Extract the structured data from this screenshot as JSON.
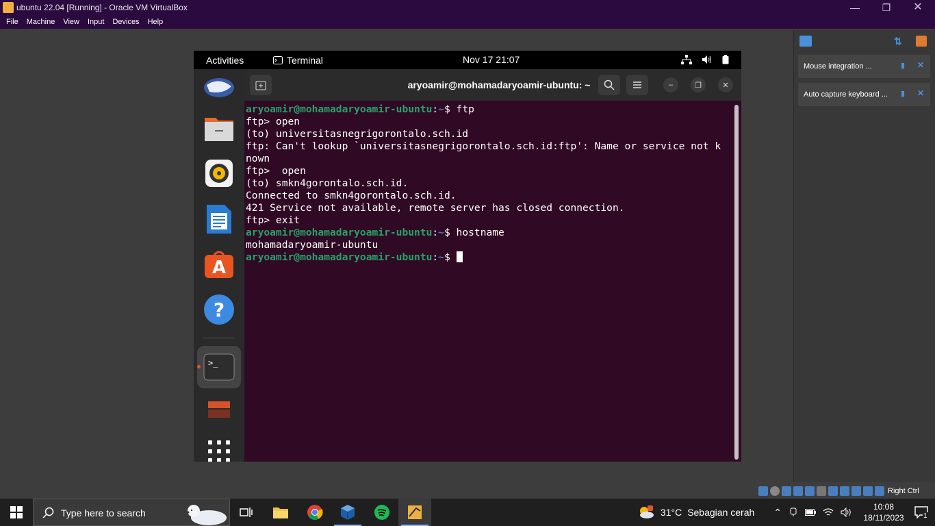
{
  "vbox": {
    "title": "ubuntu 22.04 [Running] - Oracle VM VirtualBox",
    "menu": [
      "File",
      "Machine",
      "View",
      "Input",
      "Devices",
      "Help"
    ],
    "notifications": [
      {
        "text": "Mouse integration ..."
      },
      {
        "text": "Auto capture keyboard ..."
      }
    ],
    "host_key": "Right Ctrl"
  },
  "gnome": {
    "activities": "Activities",
    "app_name": "Terminal",
    "clock": "Nov 17  21:07"
  },
  "terminal": {
    "title": "aryoamir@mohamadaryoamir-ubuntu: ~",
    "prompt_user": "aryoamir@mohamadaryoamir-ubuntu",
    "prompt_path": "~",
    "lines": [
      {
        "type": "prompt",
        "cmd": " ftp"
      },
      {
        "type": "text",
        "text": "ftp> open"
      },
      {
        "type": "text",
        "text": "(to) universitasnegrigorontalo.sch.id"
      },
      {
        "type": "text",
        "text": "ftp: Can't lookup `universitasnegrigorontalo.sch.id:ftp': Name or service not k"
      },
      {
        "type": "text",
        "text": "nown"
      },
      {
        "type": "text",
        "text": "ftp>  open"
      },
      {
        "type": "text",
        "text": "(to) smkn4gorontalo.sch.id."
      },
      {
        "type": "text",
        "text": "Connected to smkn4gorontalo.sch.id."
      },
      {
        "type": "text",
        "text": "421 Service not available, remote server has closed connection."
      },
      {
        "type": "text",
        "text": "ftp> exit"
      },
      {
        "type": "prompt",
        "cmd": " hostname"
      },
      {
        "type": "text",
        "text": "mohamadaryoamir-ubuntu"
      },
      {
        "type": "prompt",
        "cmd": " ",
        "cursor": true
      }
    ]
  },
  "taskbar": {
    "search_placeholder": "Type here to search",
    "weather_temp": "31°C",
    "weather_desc": "Sebagian cerah",
    "time": "10:08",
    "date": "18/11/2023",
    "notification_count": "1"
  },
  "colors": {
    "terminal_bg": "#300a24",
    "prompt_user": "#26a269",
    "prompt_path": "#3d86d6",
    "vbox_title_bg": "#2b0b3f"
  }
}
